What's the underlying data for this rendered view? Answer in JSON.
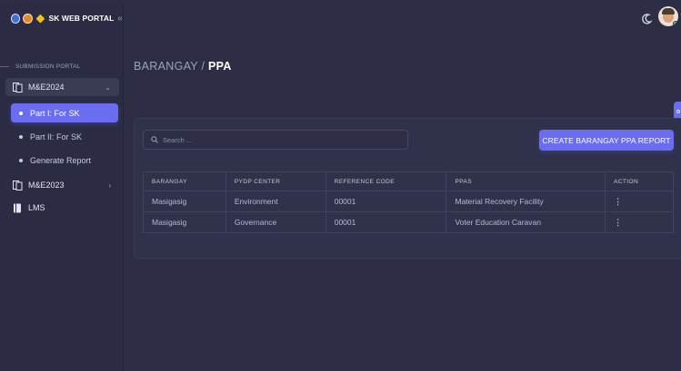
{
  "app": {
    "title": "SK WEB PORTAL"
  },
  "sidebar": {
    "section_label": "SUBMISSION PORTAL",
    "groups": [
      {
        "label": "M&E2024",
        "expanded": true
      },
      {
        "label": "M&E2023",
        "expanded": false
      },
      {
        "label": "LMS"
      }
    ],
    "subitems": [
      {
        "label": "Part I: For SK",
        "active": true
      },
      {
        "label": "Part II: For SK",
        "active": false
      },
      {
        "label": "Generate Report",
        "active": false
      }
    ]
  },
  "breadcrumb": {
    "parent": "BARANGAY / ",
    "current": "PPA"
  },
  "search": {
    "placeholder": "Search ...",
    "value": ""
  },
  "create_button": "CREATE BARANGAY PPA REPORT",
  "table": {
    "headers": [
      "BARANGAY",
      "PYDP CENTER",
      "REFERENCE CODE",
      "PPAS",
      "ACTION"
    ],
    "rows": [
      {
        "barangay": "Masigasig",
        "pydp": "Environment",
        "ref": "00001",
        "ppas": "Material Recovery Facility",
        "action": "⋮"
      },
      {
        "barangay": "Masigasig",
        "pydp": "Governance",
        "ref": "00001",
        "ppas": "Voter Education Caravan",
        "action": "⋮"
      }
    ]
  },
  "colors": {
    "accent": "#6a6df0",
    "background": "#2d2e45",
    "sidebar": "#2b2c43",
    "card": "#30314a"
  },
  "icons": [
    "logo-emblem",
    "collapse-chevrons-icon",
    "document-icon",
    "chevron-down-icon",
    "chevron-right-icon",
    "book-icon",
    "search-icon",
    "moon-icon",
    "user-avatar",
    "kebab-menu-icon"
  ]
}
